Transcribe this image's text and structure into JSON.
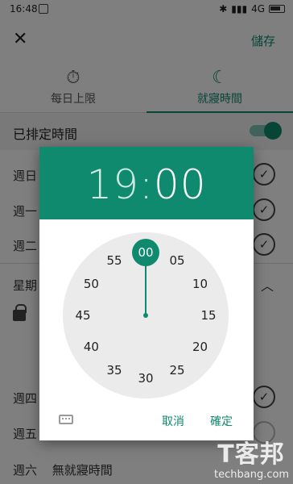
{
  "status_bar": {
    "time": "16:48",
    "network": "4G",
    "signal_icon": "signal-icon",
    "battery_icon": "battery-icon"
  },
  "top_bar": {
    "close_icon": "close-icon",
    "save_label": "儲存"
  },
  "tabs": [
    {
      "label": "每日上限",
      "icon": "stopwatch-icon",
      "active": false
    },
    {
      "label": "就寢時間",
      "icon": "moon-icon",
      "active": true
    }
  ],
  "schedule": {
    "label": "已排定時間",
    "enabled": true
  },
  "days_top": [
    "週日",
    "週一",
    "週二"
  ],
  "weekday_section": "星期",
  "days_bottom": [
    "週四",
    "週五"
  ],
  "saturday": {
    "day": "週六",
    "value": "無就寢時間"
  },
  "dialog": {
    "hour": "19",
    "colon": ":",
    "minute": "00",
    "dial_numbers": [
      "00",
      "05",
      "10",
      "15",
      "20",
      "25",
      "30",
      "35",
      "40",
      "45",
      "50",
      "55"
    ],
    "selected_minute": "00",
    "cancel_label": "取消",
    "ok_label": "確定",
    "keyboard_icon": "keyboard-icon"
  },
  "watermark": {
    "logo": "T客邦",
    "site": "techbang.com"
  },
  "colors": {
    "accent": "#0f8a6e",
    "dial_bg": "#ebebeb"
  }
}
